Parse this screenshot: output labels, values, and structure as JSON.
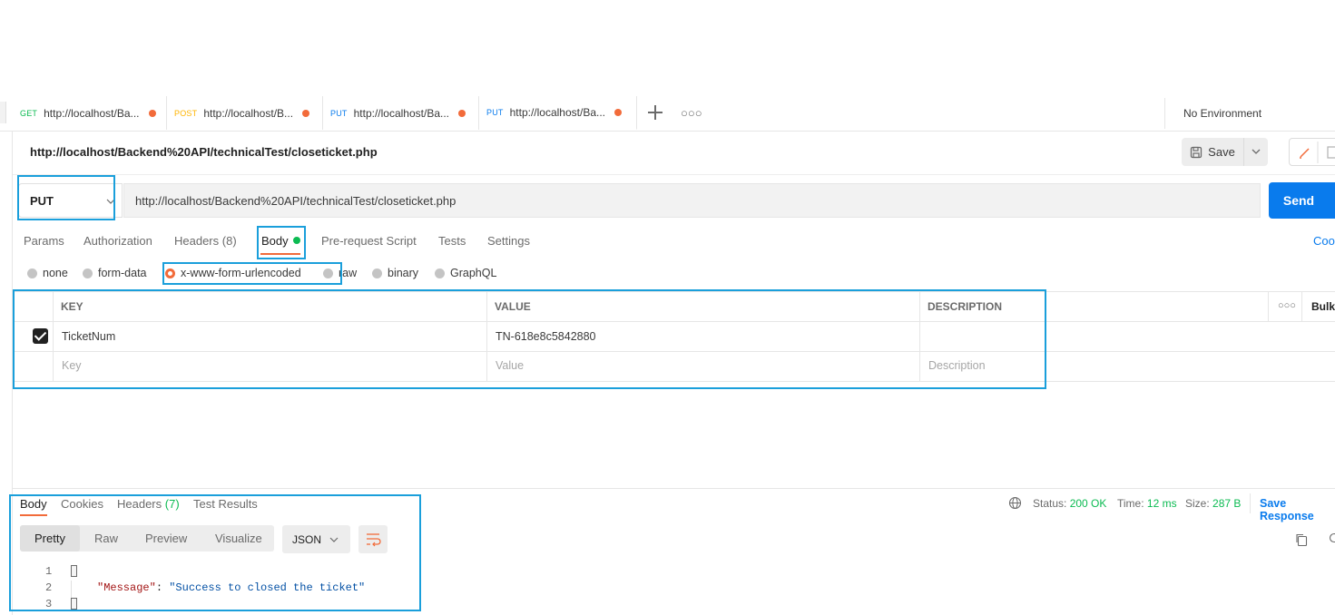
{
  "tabs": [
    {
      "method": "GET",
      "url": "http://localhost/Ba..."
    },
    {
      "method": "POST",
      "url": "http://localhost/B..."
    },
    {
      "method": "PUT",
      "url": "http://localhost/Ba..."
    },
    {
      "method": "PUT",
      "url": "http://localhost/Ba..."
    }
  ],
  "environment": "No Environment",
  "request": {
    "title": "http://localhost/Backend%20API/technicalTest/closeticket.php",
    "save_label": "Save",
    "method": "PUT",
    "url": "http://localhost/Backend%20API/technicalTest/closeticket.php",
    "send_label": "Send"
  },
  "request_tabs": {
    "params": "Params",
    "authorization": "Authorization",
    "headers": "Headers",
    "headers_count": "(8)",
    "body": "Body",
    "pre_request": "Pre-request Script",
    "tests": "Tests",
    "settings": "Settings",
    "cookies": "Coo"
  },
  "body_types": {
    "none": "none",
    "form_data": "form-data",
    "urlencoded": "x-www-form-urlencoded",
    "raw": "raw",
    "binary": "binary",
    "graphql": "GraphQL",
    "selected": "x-www-form-urlencoded"
  },
  "table": {
    "headers": {
      "key": "KEY",
      "value": "VALUE",
      "description": "DESCRIPTION",
      "bulk": "Bulk"
    },
    "rows": [
      {
        "checked": true,
        "key": "TicketNum",
        "value": "TN-618e8c5842880",
        "description": ""
      }
    ],
    "placeholders": {
      "key": "Key",
      "value": "Value",
      "description": "Description"
    }
  },
  "response": {
    "tabs": {
      "body": "Body",
      "cookies": "Cookies",
      "headers": "Headers",
      "headers_count": "(7)",
      "tests": "Test Results"
    },
    "status_label": "Status:",
    "status_value": "200 OK",
    "time_label": "Time:",
    "time_value": "12 ms",
    "size_label": "Size:",
    "size_value": "287 B",
    "save_response": "Save Response",
    "views": {
      "pretty": "Pretty",
      "raw": "Raw",
      "preview": "Preview",
      "visualize": "Visualize"
    },
    "format": "JSON",
    "lines": {
      "n1": "1",
      "n2": "2",
      "n3": "3"
    },
    "code": {
      "key": "\"Message\"",
      "colon": ": ",
      "value": "\"Success to closed the ticket\""
    }
  },
  "colors": {
    "accent": "#f26b3a",
    "send": "#097bed",
    "annotation": "#1a9fdb",
    "success": "#0cbb52"
  }
}
